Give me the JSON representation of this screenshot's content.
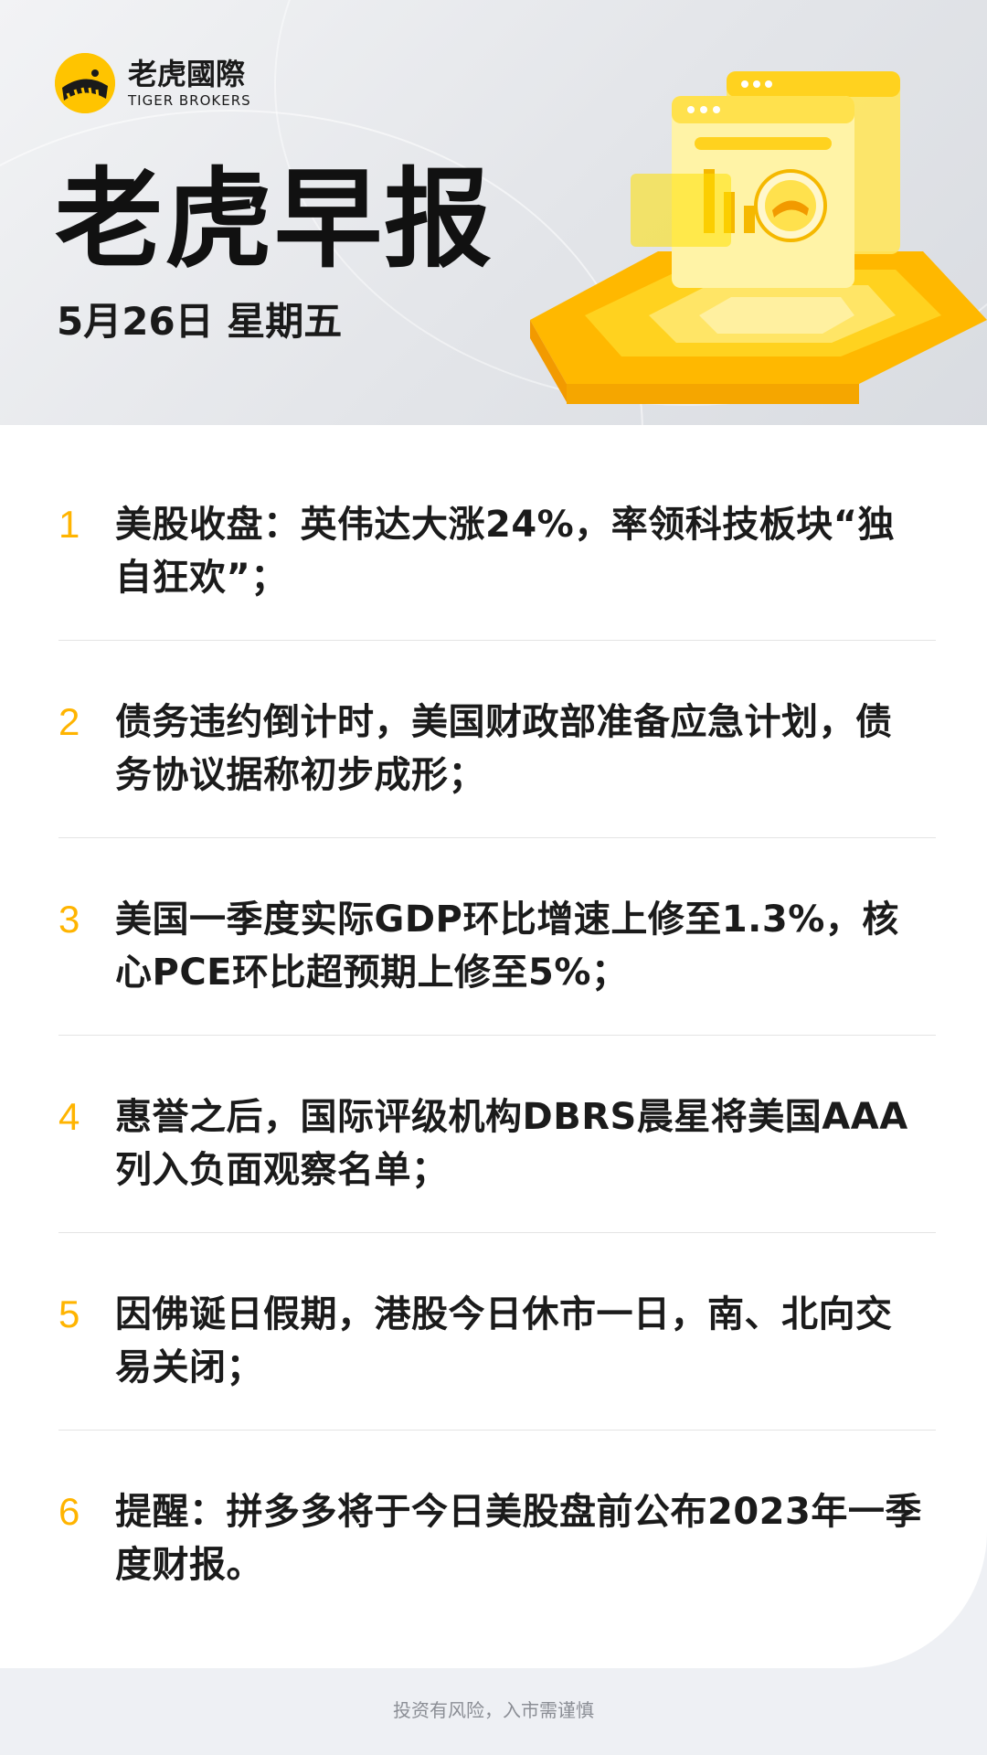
{
  "brand": {
    "name_cn": "老虎國際",
    "name_en": "TIGER BROKERS"
  },
  "title": "老虎早报",
  "date": "5月26日 星期五",
  "news": [
    {
      "num": "1",
      "text": "美股收盘：英伟达大涨24%，率领科技板块“独自狂欢”；"
    },
    {
      "num": "2",
      "text": "债务违约倒计时，美国财政部准备应急计划，债务协议据称初步成形；"
    },
    {
      "num": "3",
      "text": "美国一季度实际GDP环比增速上修至1.3%，核心PCE环比超预期上修至5%；"
    },
    {
      "num": "4",
      "text": "惠誉之后，国际评级机构DBRS晨星将美国AAA列入负面观察名单；"
    },
    {
      "num": "5",
      "text": "因佛诞日假期，港股今日休市一日，南、北向交易关闭；"
    },
    {
      "num": "6",
      "text": "提醒：拼多多将于今日美股盘前公布2023年一季度财报。"
    }
  ],
  "footer": "投资有风险，入市需谨慎",
  "colors": {
    "accent": "#FFB400",
    "logo_yellow": "#FFC400"
  }
}
